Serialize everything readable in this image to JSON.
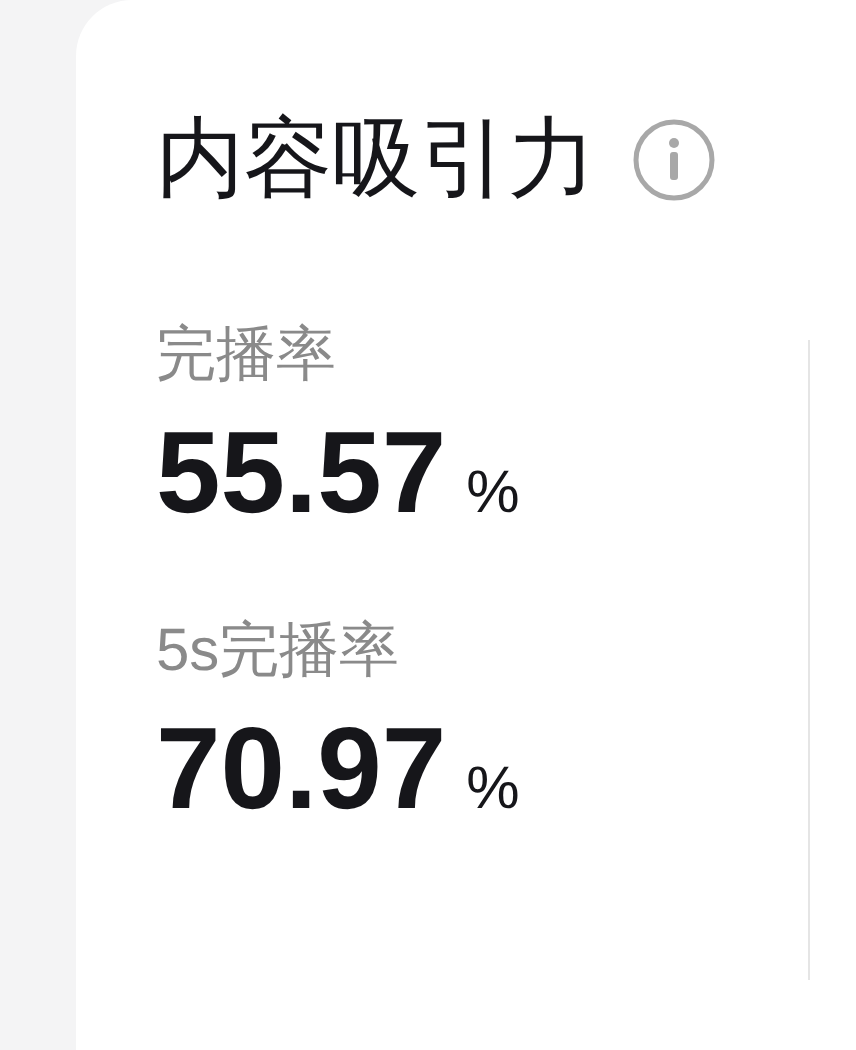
{
  "card": {
    "title": "内容吸引力",
    "metrics": [
      {
        "label": "完播率",
        "value": "55.57",
        "unit": "%"
      },
      {
        "label": "5s完播率",
        "value": "70.97",
        "unit": "%"
      }
    ]
  }
}
